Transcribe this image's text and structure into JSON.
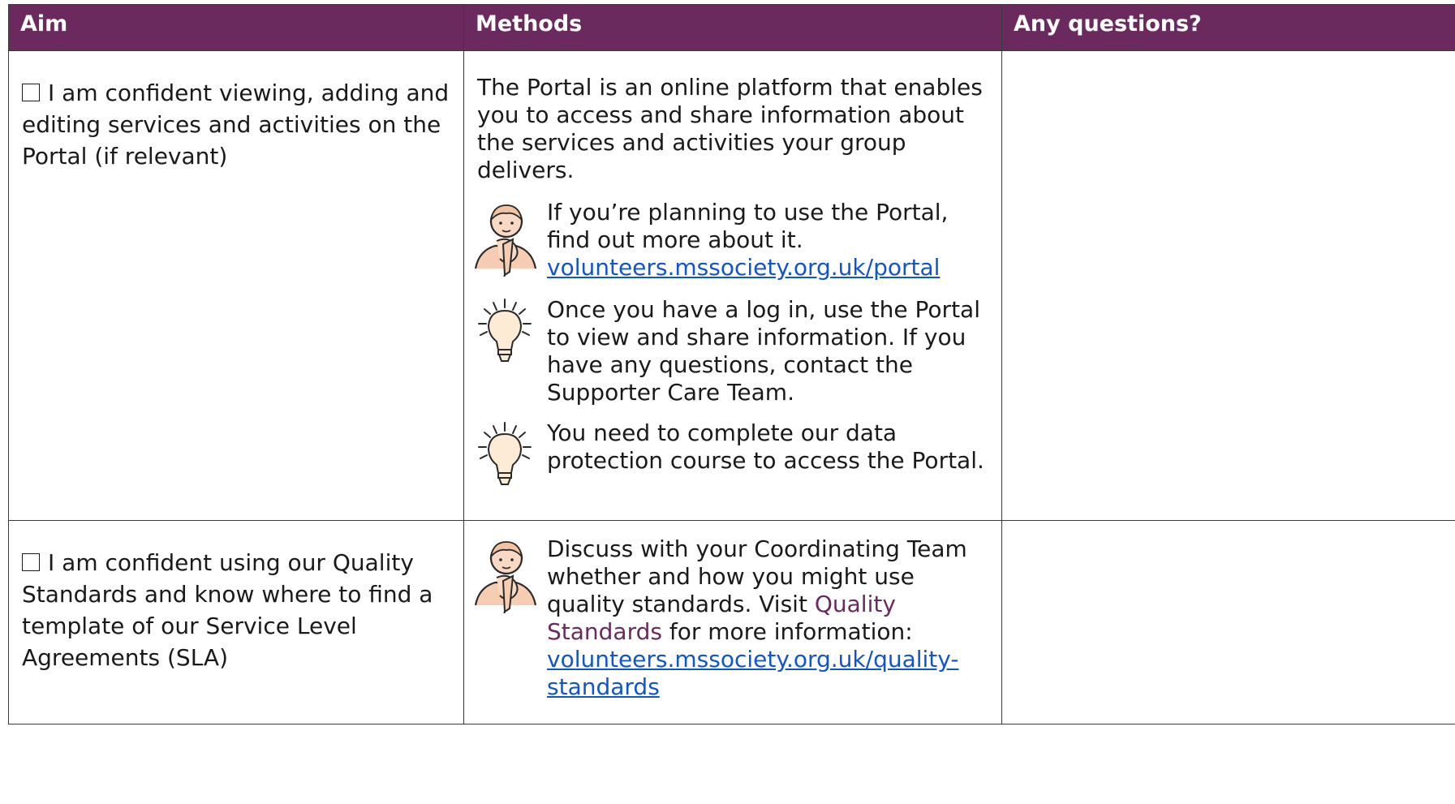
{
  "header": {
    "aim": "Aim",
    "methods": "Methods",
    "questions": "Any questions?"
  },
  "rows": [
    {
      "aim": "I am confident viewing, adding and editing services and activities on the Portal (if relevant)",
      "intro": "The Portal is an online platform that enables you to access and share information about the services and activities your group delivers.",
      "items": [
        {
          "icon": "person-thinking-icon",
          "text": "If you’re planning to use the Portal, find out more about it.",
          "link": "volunteers.mssociety.org.uk/portal"
        },
        {
          "icon": "lightbulb-icon",
          "text": "Once you have a log in, use the Portal to view and share information. If you have any questions, contact the Supporter Care Team."
        },
        {
          "icon": "lightbulb-icon",
          "text": "You need to complete our data protection course to access the Portal."
        }
      ]
    },
    {
      "aim": "I am confident using our Quality Standards and know where to find a template of our Service Level Agreements (SLA)",
      "items": [
        {
          "icon": "person-thinking-icon",
          "text_before": "Discuss with your Coordinating Team whether and how you might use quality standards. Visit ",
          "highlight": "Quality Standards",
          "text_after": " for more information:",
          "link": "volunteers.mssociety.org.uk/quality-standards"
        }
      ]
    }
  ],
  "colors": {
    "header_bg": "#6a2a5e",
    "link": "#1155cc",
    "accent": "#6a2a5e"
  }
}
